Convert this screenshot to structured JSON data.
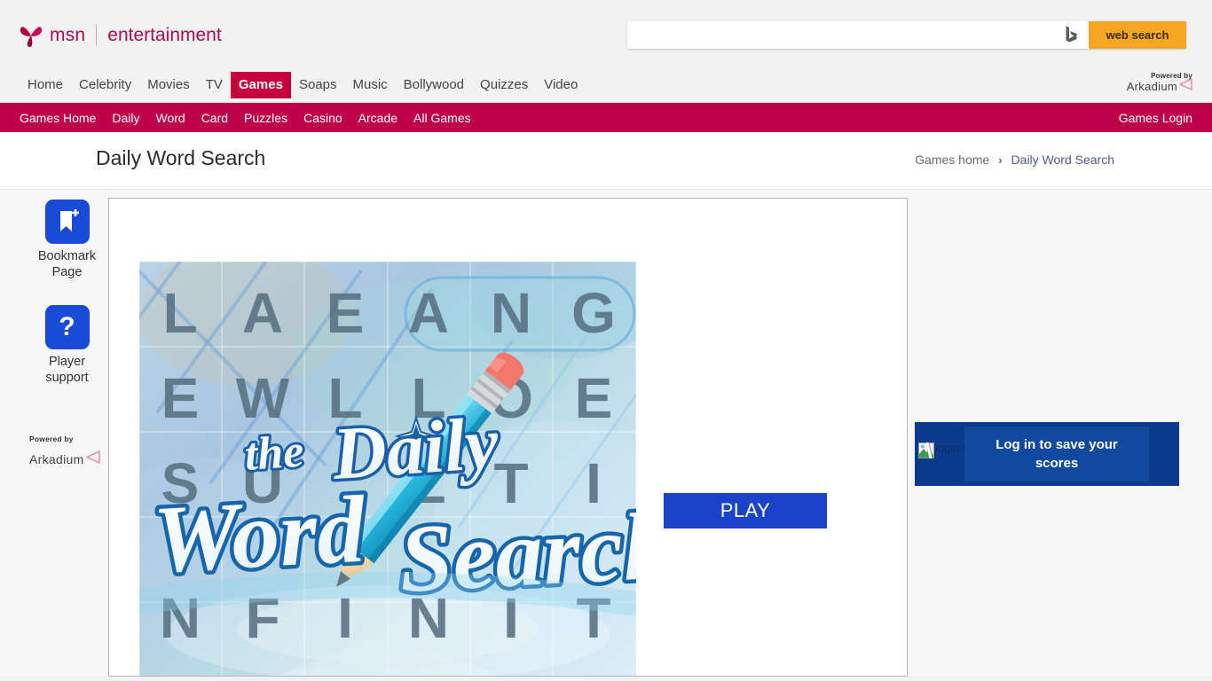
{
  "header": {
    "brand_name": "msn",
    "brand_section": "entertainment",
    "butterfly_icon": "msn-butterfly-icon",
    "search": {
      "value": "",
      "placeholder": "",
      "bing_icon": "bing-b-icon",
      "button_label": "web search"
    },
    "arkadium": {
      "powered_by": "Powered by",
      "name": "Arkadium",
      "mark_icon": "arkadium-arrow-icon"
    }
  },
  "main_nav": {
    "items": [
      {
        "label": "Home",
        "active": false
      },
      {
        "label": "Celebrity",
        "active": false
      },
      {
        "label": "Movies",
        "active": false
      },
      {
        "label": "TV",
        "active": false
      },
      {
        "label": "Games",
        "active": true
      },
      {
        "label": "Soaps",
        "active": false
      },
      {
        "label": "Music",
        "active": false
      },
      {
        "label": "Bollywood",
        "active": false
      },
      {
        "label": "Quizzes",
        "active": false
      },
      {
        "label": "Video",
        "active": false
      }
    ]
  },
  "games_nav": {
    "items": [
      {
        "label": "Games Home"
      },
      {
        "label": "Daily"
      },
      {
        "label": "Word"
      },
      {
        "label": "Card"
      },
      {
        "label": "Puzzles"
      },
      {
        "label": "Casino"
      },
      {
        "label": "Arcade"
      },
      {
        "label": "All Games"
      }
    ],
    "login_label": "Games Login"
  },
  "page": {
    "title": "Daily Word Search",
    "breadcrumb": {
      "home_label": "Games home",
      "separator": "›",
      "current_label": "Daily Word Search"
    }
  },
  "left_rail": {
    "bookmark": {
      "icon": "bookmark-add-icon",
      "label_line1": "Bookmark",
      "label_line2": "Page"
    },
    "support": {
      "icon": "question-mark-icon",
      "label_line1": "Player",
      "label_line2": "support"
    },
    "arkadium": {
      "powered_by": "Powered by",
      "name": "Arkadium",
      "mark_icon": "arkadium-arrow-icon"
    }
  },
  "game_panel": {
    "thumbnail": {
      "alt": "The Daily Word Search",
      "logo_word_the": "the",
      "logo_word_daily": "Daily",
      "logo_word_word": "Word",
      "logo_word_search": "Search",
      "grid_rows": [
        "L A E A N G",
        "E W L L O E",
        "S U   L T I",
        "N F I N I T"
      ],
      "pencil_icon": "pencil-icon"
    },
    "play_button_label": "PLAY"
  },
  "login_panel": {
    "broken_image_icon": "broken-image-icon",
    "broken_image_alt": "login button",
    "button_label": "Log in to save your scores"
  },
  "colors": {
    "msn_crimson": "#a80d4a",
    "nav_active": "#c5003e",
    "games_bar": "#bd0049",
    "search_orange": "#f5a623",
    "accent_blue": "#1a43c8",
    "login_panel_bg": "#0b3b8c",
    "login_button_bg": "#11499e",
    "page_bg": "#f7f7f7"
  }
}
